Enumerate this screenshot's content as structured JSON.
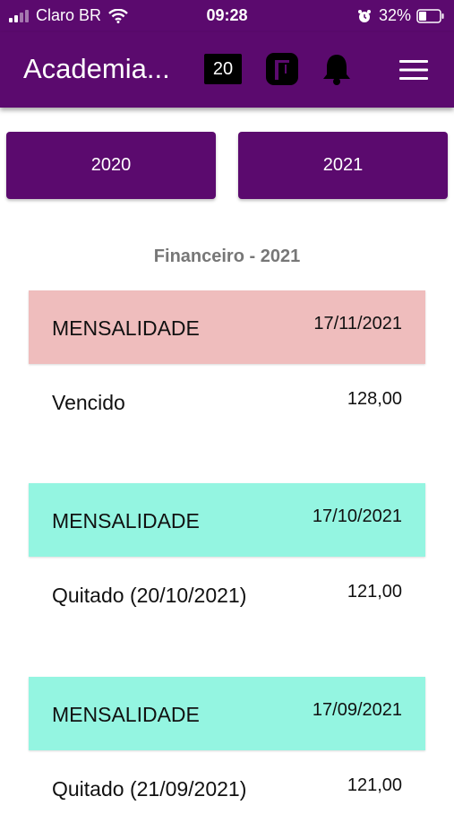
{
  "status_bar": {
    "carrier": "Claro BR",
    "time": "09:28",
    "battery_percent": "32%",
    "signal_bars": 4,
    "signal_bars_active": 2
  },
  "header": {
    "title": "Academia...",
    "counter": "20",
    "icons": [
      "gym-icon",
      "bell-icon",
      "menu-icon"
    ]
  },
  "year_buttons": [
    "2020",
    "2021"
  ],
  "section_title": "Financeiro - 2021",
  "colors": {
    "primary": "#5b0a6e",
    "overdue": "#efbdbd",
    "paid": "#94f5e1"
  },
  "entries": [
    {
      "type": "MENSALIDADE",
      "date": "17/11/2021",
      "status": "Vencido",
      "value": "128,00",
      "state": "overdue"
    },
    {
      "type": "MENSALIDADE",
      "date": "17/10/2021",
      "status": "Quitado (20/10/2021)",
      "value": "121,00",
      "state": "paid"
    },
    {
      "type": "MENSALIDADE",
      "date": "17/09/2021",
      "status": "Quitado (21/09/2021)",
      "value": "121,00",
      "state": "paid"
    }
  ]
}
